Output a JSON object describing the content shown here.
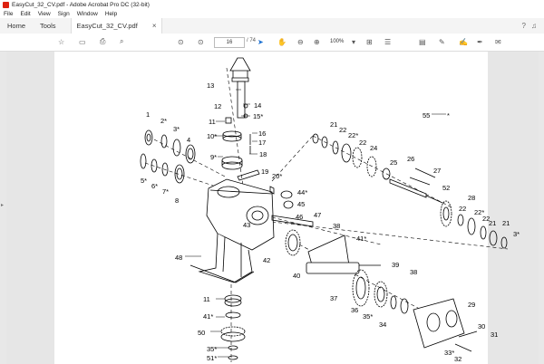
{
  "window": {
    "title": "EasyCut_32_CV.pdf - Adobe Acrobat Pro DC (32-bit)"
  },
  "menu": [
    "File",
    "Edit",
    "View",
    "Sign",
    "Window",
    "Help"
  ],
  "tabs": {
    "home": "Home",
    "tools": "Tools",
    "document": "EasyCut_32_CV.pdf"
  },
  "toolbar": {
    "page_current": "16",
    "page_total": "/ 74",
    "zoom": "100%"
  },
  "diagram": {
    "labels": [
      "1",
      "2*",
      "3*",
      "4",
      "5*",
      "6*",
      "7*",
      "8",
      "9*",
      "10*",
      "11",
      "12",
      "13",
      "14",
      "15*",
      "16",
      "17",
      "18",
      "19",
      "20*",
      "21",
      "22",
      "22*",
      "24",
      "25",
      "26",
      "27",
      "28",
      "29",
      "30",
      "31",
      "32",
      "33*",
      "34",
      "35*",
      "36",
      "37",
      "38",
      "39",
      "40",
      "41*",
      "42",
      "43",
      "44*",
      "45",
      "46",
      "47",
      "48",
      "50",
      "51*",
      "52",
      "55",
      "*"
    ]
  }
}
